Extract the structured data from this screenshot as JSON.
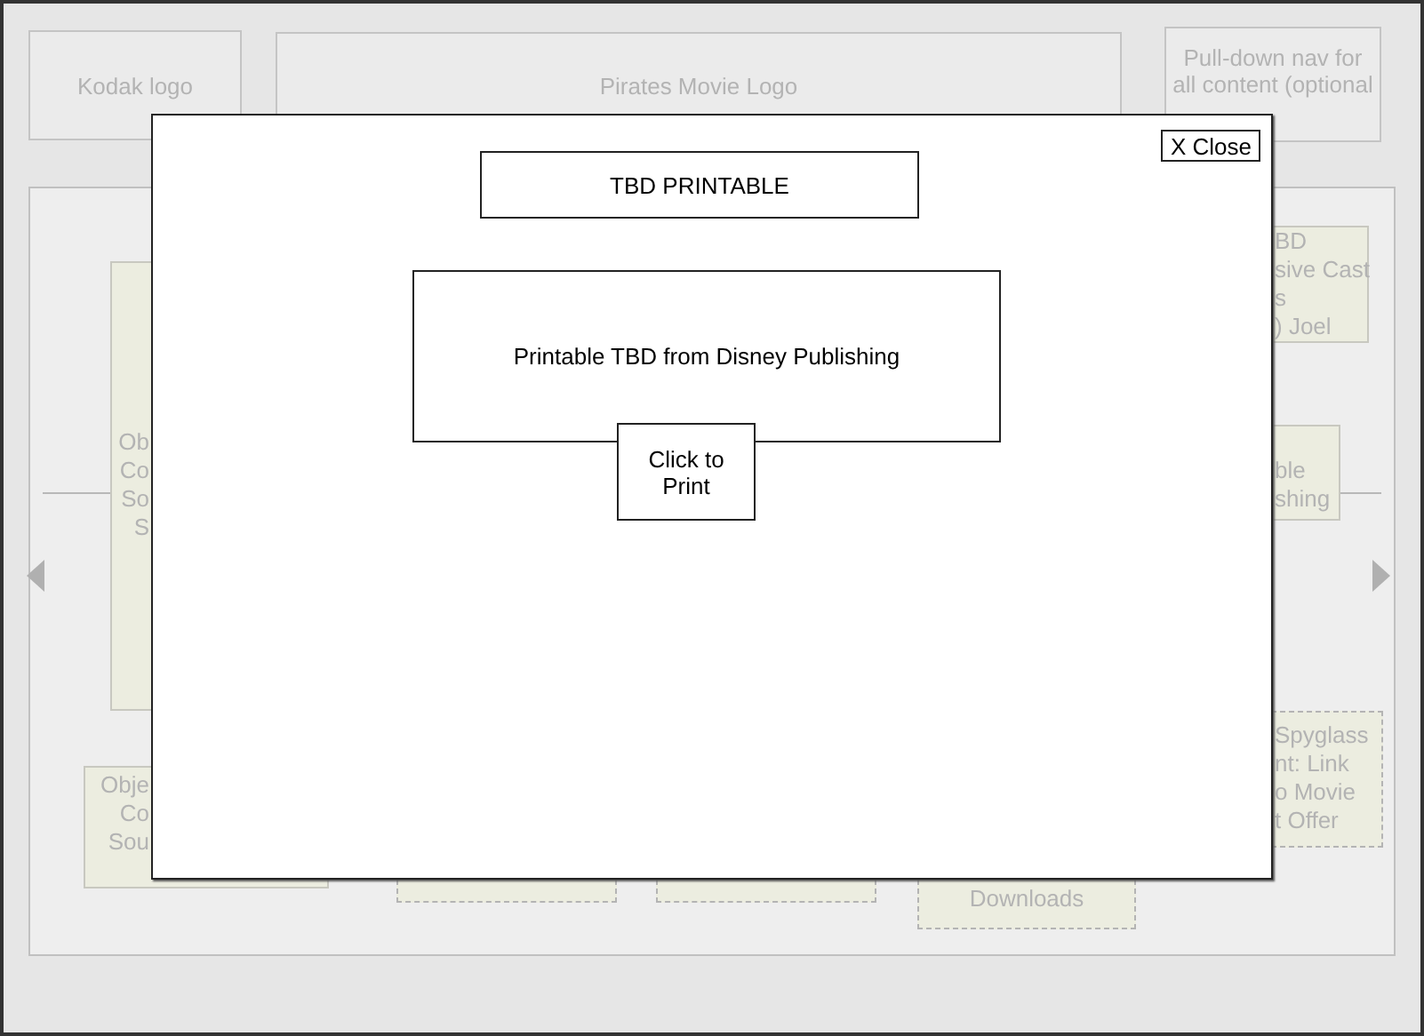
{
  "header": [
    {
      "kind": "logo",
      "lines": [
        "Kodak logo"
      ]
    },
    {
      "kind": "logo",
      "lines": [
        "Pirates Movie Logo"
      ]
    },
    {
      "kind": "nav",
      "lines": [
        "Pull-down nav for",
        "all content (optional"
      ]
    }
  ],
  "content": {
    "boxes": [
      {
        "kind": "solid",
        "lines": [
          "BD",
          "sive Cast",
          "s",
          ") Joel"
        ]
      },
      {
        "kind": "solid",
        "lines": [
          "Ob",
          "Co",
          "So",
          "S"
        ]
      },
      {
        "kind": "solid",
        "lines": [
          "ble",
          "shing"
        ]
      },
      {
        "kind": "dashed",
        "lines": [
          "Spyglass",
          "nt: Link",
          "o Movie",
          "t Offer"
        ]
      },
      {
        "kind": "solid",
        "lines": [
          "Obje",
          "Co",
          "Sou"
        ]
      },
      {
        "kind": "dashed"
      },
      {
        "kind": "dashed"
      },
      {
        "kind": "dashed",
        "lines": [
          "Downloads"
        ]
      }
    ]
  },
  "modal": {
    "close": "X Close",
    "title": "TBD PRINTABLE",
    "body": "Printable TBD from Disney Publishing",
    "print_button": [
      "Click to",
      "Print"
    ]
  }
}
